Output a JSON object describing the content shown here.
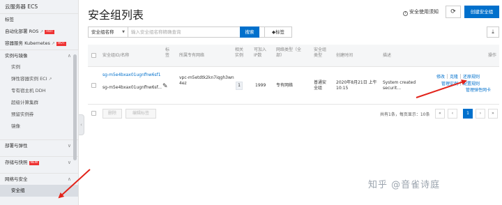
{
  "sidebar": {
    "title": "云服务器 ECS",
    "items": [
      {
        "label": "标签",
        "sub": false,
        "group": false
      },
      {
        "label": "自动化部署 ROS",
        "ext": "↗",
        "badge": "HOT",
        "sub": false
      },
      {
        "label": "容器服务 Kubernetes",
        "ext": "↗",
        "badge": "HOT",
        "sub": false
      },
      {
        "label": "实例与镜像",
        "chevron": "∧",
        "group": true
      },
      {
        "label": "实例",
        "sub": true
      },
      {
        "label": "弹性容器实例 ECI",
        "ext": "↗",
        "sub": true
      },
      {
        "label": "专有宿主机 DDH",
        "sub": true
      },
      {
        "label": "超级计算集群",
        "sub": true
      },
      {
        "label": "预留实例券",
        "sub": true
      },
      {
        "label": "镜像",
        "sub": true
      },
      {
        "label": "部署与弹性",
        "chevron": "∨",
        "group": true
      },
      {
        "label": "存储与快照",
        "badge": "NEW",
        "chevron": "∨",
        "group": true
      },
      {
        "label": "网络与安全",
        "chevron": "∧",
        "group": true
      },
      {
        "label": "安全组",
        "sub": true,
        "active": true
      }
    ]
  },
  "header": {
    "title": "安全组列表",
    "safety_link": "安全使用须知",
    "refresh_icon": "⟳",
    "create_label": "创建安全组"
  },
  "search": {
    "select_value": "安全组名称",
    "placeholder": "输入安全组名称精确查询",
    "search_label": "搜索",
    "tag_label": "标签",
    "export_icon": "⤓"
  },
  "table": {
    "columns": {
      "id_name": "安全组ID/名称",
      "tag": "标签",
      "vpc": "所属专有网络",
      "related": "相关实例",
      "joinable_ip": "可加入IP数",
      "network_type": "网络类型（全部）",
      "sg_type": "安全组类型",
      "created": "创建时间",
      "desc": "描述",
      "ops": "操作"
    },
    "rows": [
      {
        "id": "sg-m5e4bxax01ugnfhw6sf1",
        "name": "sg-m5e4bxax01ugnfhw6sf...",
        "vpc": "vpc-m5etdtk2kn7iqgh3wn4ez",
        "related": "1",
        "joinable_ip": "1999",
        "network_type": "专有网络",
        "sg_type": "普通安全组",
        "created": "2020年8月21日 上午10:15",
        "desc": "System created securit...",
        "ops": {
          "modify": "修改",
          "clone": "克隆",
          "restore": "还原规则",
          "manage_instance": "管理实例",
          "config_rules": "配置规则",
          "manage_eni": "管理弹性网卡"
        }
      }
    ]
  },
  "footer": {
    "delete_label": "删除",
    "edit_tag_label": "编辑标签",
    "pager_info": "共有1条，每页显示：10条",
    "pages": [
      "«",
      "‹",
      "1",
      "›",
      "»"
    ],
    "current_page": "1"
  },
  "watermark": "知乎 @音雀诗庭",
  "colors": {
    "primary": "#0070cc",
    "arrow": "#e2231a"
  }
}
